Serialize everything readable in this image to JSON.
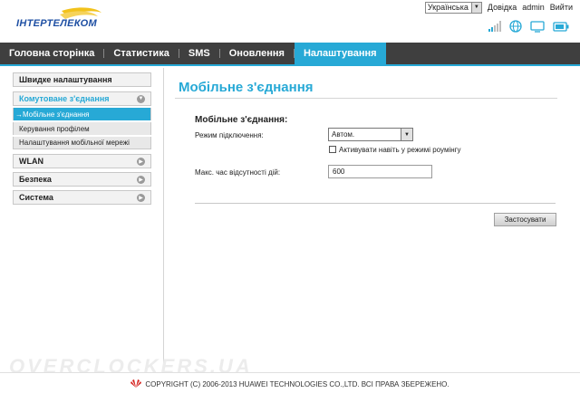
{
  "header": {
    "logo_text": "ІНТЕРТЕЛЕКОМ",
    "language": "Українська",
    "help_link": "Довідка",
    "user_link": "admin",
    "logout_link": "Вийти"
  },
  "status_icons": [
    "signal-icon",
    "globe-icon",
    "monitor-icon",
    "battery-icon"
  ],
  "nav": {
    "items": [
      {
        "label": "Головна сторінка",
        "active": false
      },
      {
        "label": "Статистика",
        "active": false
      },
      {
        "label": "SMS",
        "active": false
      },
      {
        "label": "Оновлення",
        "active": false
      },
      {
        "label": "Налаштування",
        "active": true
      }
    ]
  },
  "sidebar": {
    "quick_setup": "Швидке налаштування",
    "dialup": {
      "title": "Комутоване з'єднання",
      "items": [
        {
          "label": "Мобільне з'єднання",
          "active": true
        },
        {
          "label": "Керування профілем",
          "active": false
        },
        {
          "label": "Налаштування мобільної мережі",
          "active": false
        }
      ]
    },
    "wlan": "WLAN",
    "security": "Безпека",
    "system": "Система"
  },
  "main": {
    "page_title": "Мобільне з'єднання",
    "section_title": "Мобільне з'єднання:",
    "mode_label": "Режим підключення:",
    "mode_value": "Автом.",
    "roaming_label": "Активувати навіть у режимі роумінгу",
    "roaming_checked": false,
    "idle_label": "Макс. час відсутності дій:",
    "idle_value": "600",
    "apply_button": "Застосувати"
  },
  "footer": {
    "watermark": "OVERCLOCKERS.UA",
    "copyright": "COPYRIGHT (C) 2006-2013 HUAWEI TECHNOLOGIES CO.,LTD. ВСІ ПРАВА ЗБЕРЕЖЕНО."
  },
  "colors": {
    "accent": "#27a9d6",
    "nav_bg": "#3f3f3f",
    "logo_blue": "#1e4fa3",
    "logo_yellow": "#f2c21b",
    "signal_bars": "#bdbdbd",
    "signal_active": "#27a9d6",
    "huawei_red": "#d6231f"
  }
}
